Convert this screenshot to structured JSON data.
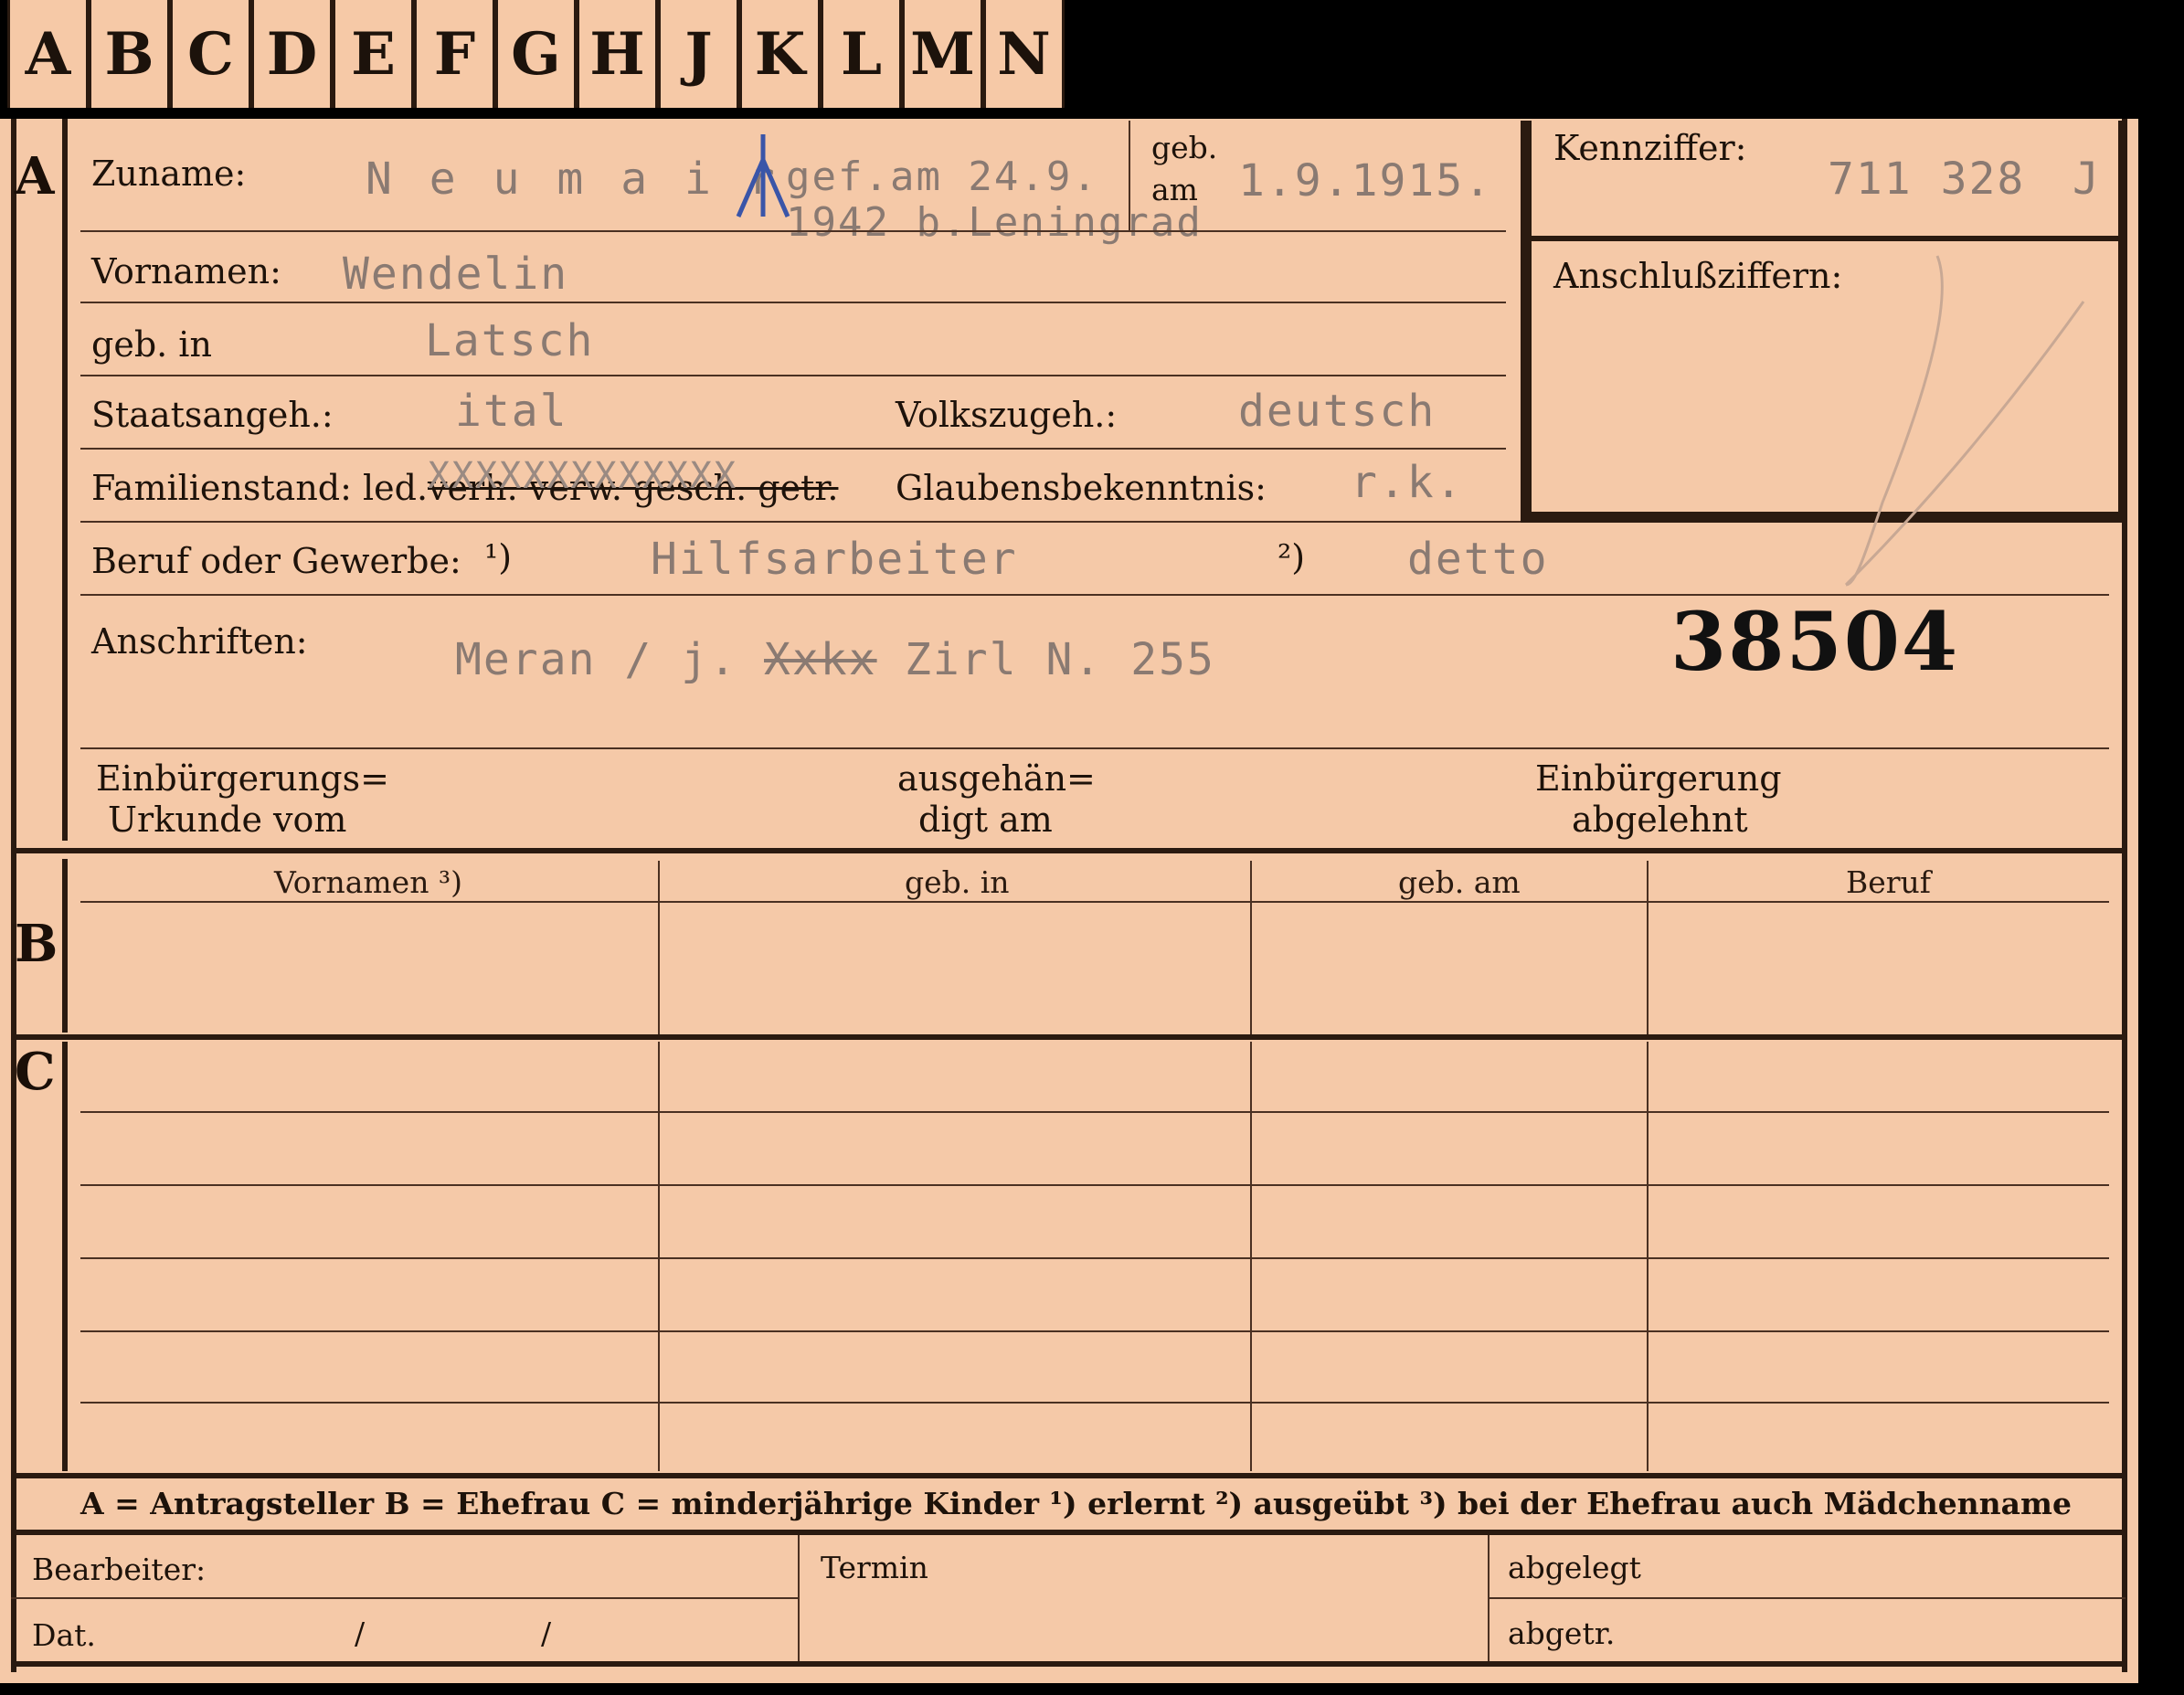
{
  "tabs": [
    "A",
    "B",
    "C",
    "D",
    "E",
    "F",
    "G",
    "H",
    "J",
    "K",
    "L",
    "M",
    "N"
  ],
  "sections": {
    "a": "A",
    "b": "B",
    "c": "C"
  },
  "labels": {
    "zuname": "Zuname:",
    "geb_am": "geb.",
    "geb_am2": "am",
    "vornamen": "Vornamen:",
    "geb_in": "geb. in",
    "staatsangeh": "Staatsangeh.:",
    "volkszugeh": "Volkszugeh.:",
    "familienstand": "Familienstand: led.",
    "familienstand_struck": "verh. verw. gesch. getr.",
    "glaubens": "Glaubensbekenntnis:",
    "beruf": "Beruf oder Gewerbe:",
    "beruf_fn1": "¹)",
    "beruf_fn2": "²)",
    "anschriften": "Anschriften:",
    "einb_urkunde_1": "Einbürgerungs=",
    "einb_urkunde_2": "Urkunde vom",
    "ausgehaen_1": "ausgehän=",
    "ausgehaen_2": "digt am",
    "einb_abgelehnt_1": "Einbürgerung",
    "einb_abgelehnt_2": "abgelehnt",
    "kennziffer": "Kennziffer:",
    "anschlussziffern": "Anschlußziffern:"
  },
  "values": {
    "zuname": "N e u m a i r",
    "zuname_note_1": "gef.am 24.9.",
    "zuname_note_2": "1942 b.Leningrad",
    "geb_am": "1.9.1915.",
    "vornamen": "Wendelin",
    "geb_in": "Latsch",
    "staatsangeh": "ital",
    "volkszugeh": "deutsch",
    "familienstand_overtype": "XXXXXXXXXXXXX",
    "glaubens": "r.k.",
    "beruf_1": "Hilfsarbeiter",
    "beruf_2": "detto",
    "anschrift_1": "Meran / j.",
    "anschrift_struck": "Xxkx",
    "anschrift_2": "Zirl N. 255",
    "stamp_number": "38504",
    "kennziffer": "711 328",
    "kennziffer_suffix": "J"
  },
  "table": {
    "headers": [
      "Vornamen ³)",
      "geb. in",
      "geb. am",
      "Beruf"
    ]
  },
  "legend": "A = Antragsteller   B = Ehefrau   C = minderjährige Kinder   ¹) erlernt   ²) ausgeübt   ³) bei der Ehefrau auch Mädchenname",
  "footer": {
    "bearbeiter": "Bearbeiter:",
    "termin": "Termin",
    "abgelegt": "abgelegt",
    "dat": "Dat.",
    "slash1": "/",
    "slash2": "/",
    "abgetr": "abgetr."
  },
  "colors": {
    "card": "#f5c9a8",
    "ink": "#1a0f08",
    "typewriter": "#8a7a72",
    "stamp": "#111111",
    "pencil_mark": "#3a55a8"
  }
}
